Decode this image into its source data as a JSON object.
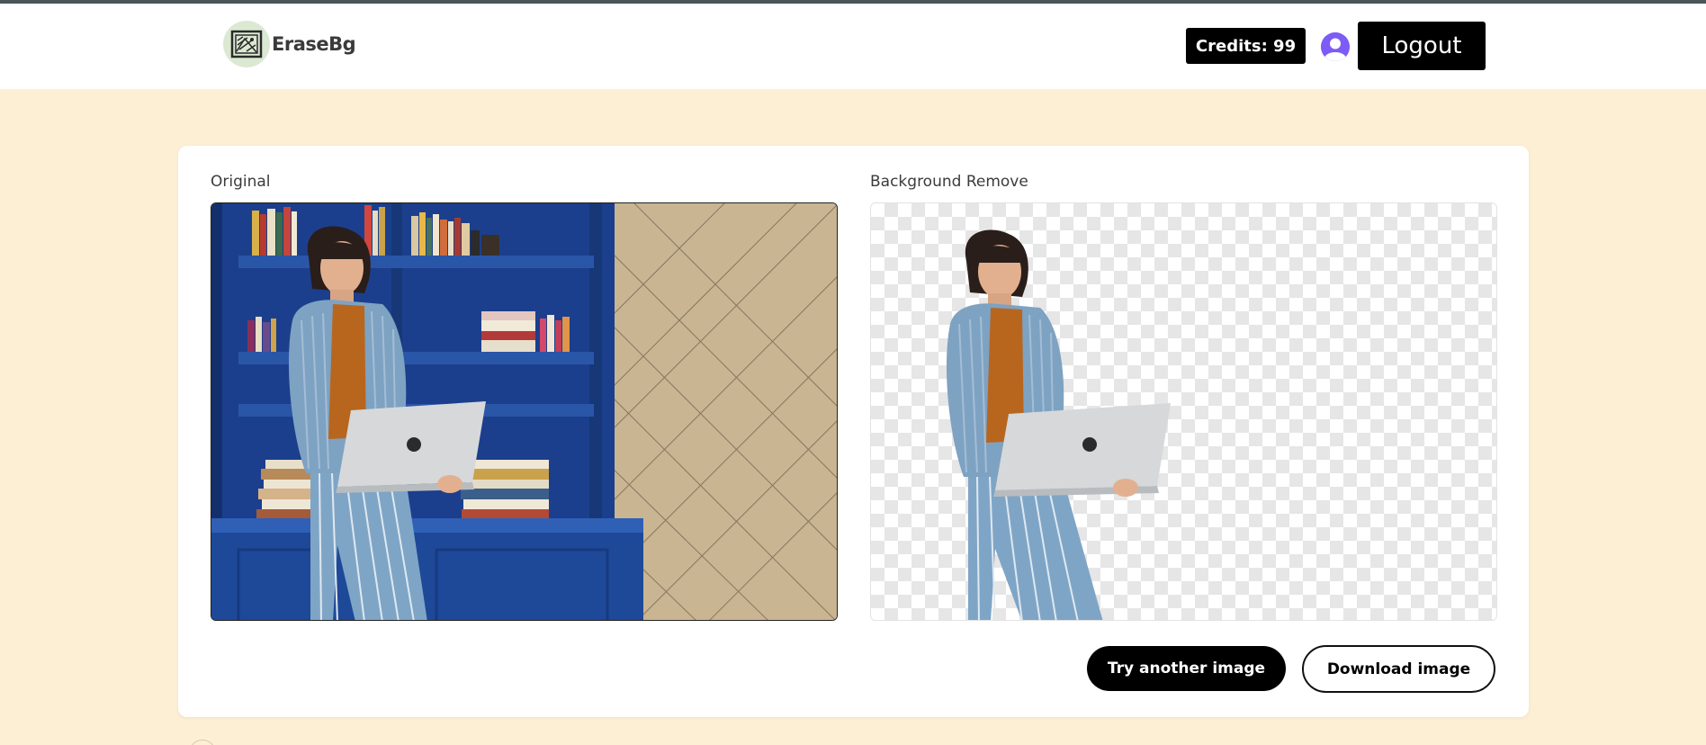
{
  "header": {
    "app_name": "EraseBg",
    "logo_icon": "picture-frame-icon",
    "credits_label": "Credits: 99",
    "avatar_icon": "user-avatar-icon",
    "logout_label": "Logout"
  },
  "main": {
    "original_label": "Original",
    "removed_label": "Background Remove",
    "try_another_label": "Try another image",
    "download_label": "Download image"
  },
  "colors": {
    "page_background": "#fdefd4",
    "header_background": "#ffffff",
    "primary_button": "#000000",
    "avatar": "#7c5cf5",
    "logo_badge": "#dce9d2"
  }
}
